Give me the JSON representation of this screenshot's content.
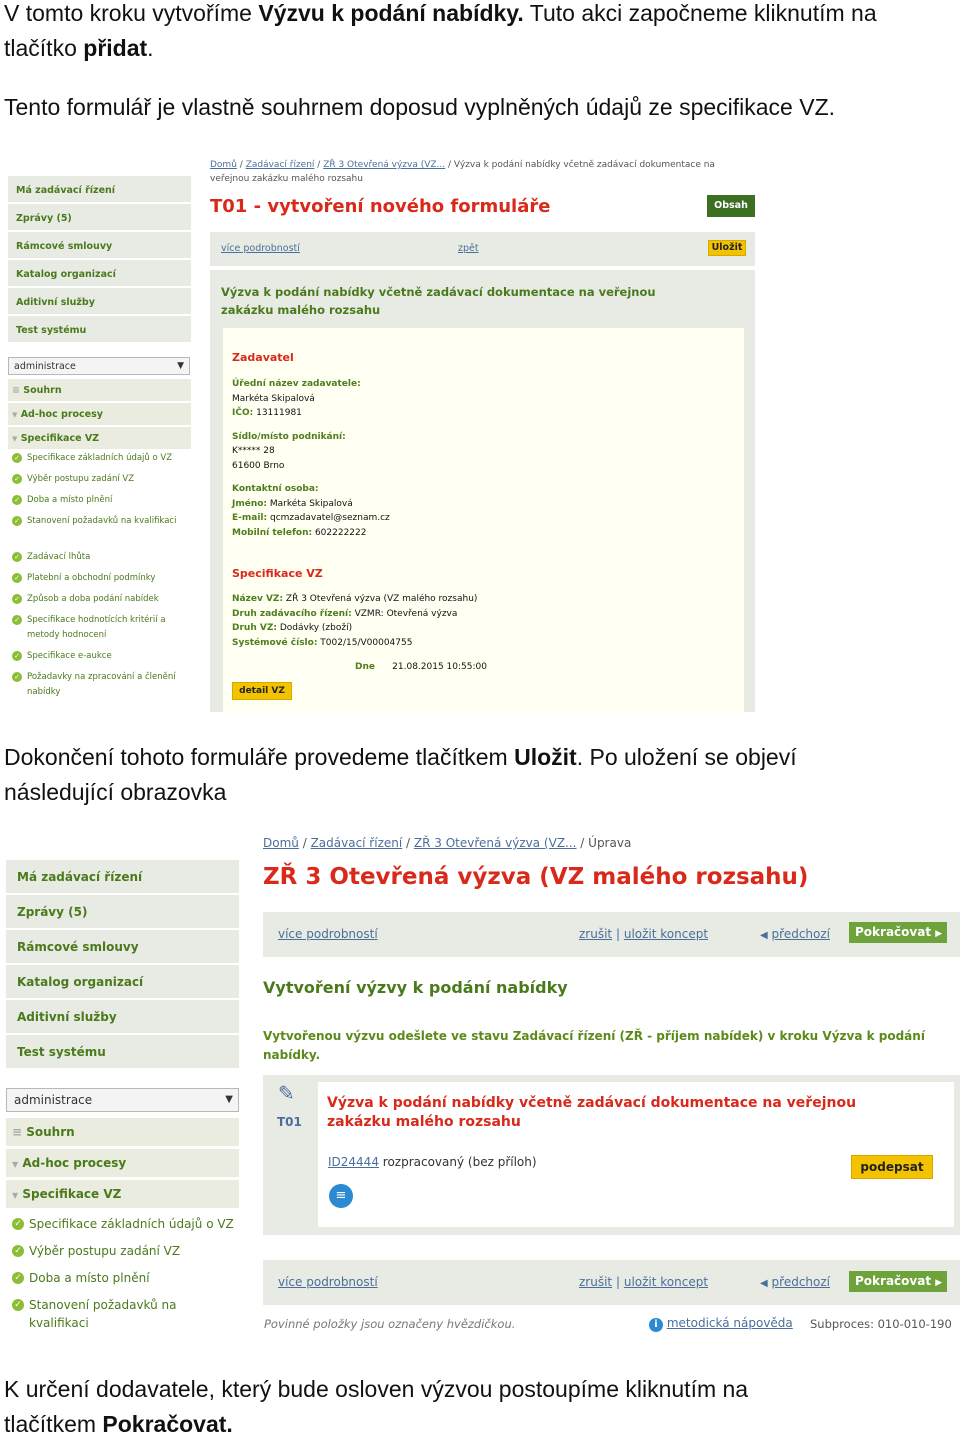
{
  "p1": {
    "a": "V tomto kroku vytvoříme ",
    "b": "Výzvu k podání nabídky.",
    "c": " Tuto akci započneme kliknutím na",
    "d": "tlačítko ",
    "e": "přidat",
    "f": "."
  },
  "p2": "Tento formulář je vlastně souhrnem doposud vyplněných údajů ze specifikace VZ.",
  "p3": {
    "a": "Dokončení tohoto formuláře provedeme tlačítkem ",
    "b": "Uložit",
    "c": ". Po uložení se objeví",
    "d": "následující obrazovka"
  },
  "p4": {
    "a": "K určení dodavatele, který bude osloven výzvou postoupíme kliknutím na",
    "b": "tlačítkem ",
    "c": "Pokračovat."
  },
  "sidebar": {
    "items": [
      "Má zadávací řízení",
      "Zprávy (5)",
      "Rámcové smlouvy",
      "Katalog organizací",
      "Aditivní služby",
      "Test systému"
    ],
    "dropdown": "administrace",
    "summary": "Souhrn",
    "adhoc": "Ad-hoc procesy",
    "spec": "Specifikace VZ",
    "tasks1": [
      "Specifikace základních údajů o VZ",
      "Výběr postupu zadání VZ",
      "Doba a místo plnění",
      "Stanovení požadavků na kvalifikaci",
      "Zadávací lhůta",
      "Platební a obchodní podmínky",
      "Způsob a doba podání nabídek",
      "Specifikace hodnotících kritérií a metody hodnocení",
      "Specifikace e-aukce",
      "Požadavky na zpracování a členění nabídky"
    ],
    "tasks2": [
      "Specifikace základních údajů o VZ",
      "Výběr postupu zadání VZ",
      "Doba a místo plnění",
      "Stanovení požadavků na kvalifikaci"
    ]
  },
  "s1": {
    "bc_home": "Domů",
    "bc_zr": "Zadávací řízení",
    "bc_vz": "ZŘ 3 Otevřená výzva (VZ...",
    "bc_cur1": "Výzva k podání nabídky včetně zadávací dokumentace na",
    "bc_cur2": "veřejnou zakázku malého rozsahu",
    "title": "T01 - vytvoření nového formuláře",
    "obsah": "Obsah",
    "more": "více podrobností",
    "back": "zpět",
    "save": "Uložit",
    "form_title1": "Výzva k podání nabídky včetně zadávací dokumentace na veřejnou",
    "form_title2": "zakázku malého rozsahu",
    "zad_head": "Zadavatel",
    "name_lbl": "Úřední název zadavatele:",
    "name_val": "Markéta Skipalová",
    "ico_lbl": "IČO:",
    "ico_val": "13111981",
    "addr_lbl": "Sídlo/místo podnikání:",
    "addr1": "K***** 28",
    "addr2": "61600  Brno",
    "contact_lbl": "Kontaktní osoba:",
    "jm_lbl": "Jméno:",
    "jm_val": "Markéta Skipalová",
    "em_lbl": "E-mail:",
    "em_val": "qcmzadavatel@seznam.cz",
    "tel_lbl": "Mobilní telefon:",
    "tel_val": "602222222",
    "spec_head": "Specifikace VZ",
    "nazev_lbl": "Název VZ:",
    "nazev_val": "ZŘ 3 Otevřená výzva (VZ malého rozsahu)",
    "druh_zr_lbl": "Druh zadávacího řízení:",
    "druh_zr_val": "VZMR: Otevřená výzva",
    "druh_vz_lbl": "Druh VZ:",
    "druh_vz_val": "Dodávky (zboží)",
    "sys_lbl": "Systémové číslo:",
    "sys_val": "T002/15/V00004755",
    "dne_lbl": "Dne",
    "dne_val": "21.08.2015 10:55:00",
    "detail": "detail VZ"
  },
  "s2": {
    "bc_home": "Domů",
    "bc_zr": "Zadávací řízení",
    "bc_vz": "ZŘ 3 Otevřená výzva (VZ...",
    "bc_cur": "Úprava",
    "title": "ZŘ 3 Otevřená výzva (VZ malého rozsahu)",
    "more": "více podrobností",
    "cancel": "zrušit",
    "sep": "|",
    "draft": "uložit koncept",
    "prev": "předchozí",
    "next": "Pokračovat",
    "sub_title": "Vytvoření výzvy k podání nabídky",
    "info1": "Vytvořenou výzvu odešlete ve stavu Zadávací řízení (ZŘ - příjem nabídek) v kroku Výzva k podání",
    "info2": "nabídky.",
    "doc_code": "T01",
    "doc_title1": "Výzva k podání nabídky včetně zadávací dokumentace na veřejnou",
    "doc_title2": "zakázku malého rozsahu",
    "doc_id": "ID24444",
    "doc_state": "rozpracovaný (bez příloh)",
    "sign": "podepsat",
    "footer_note": "Povinné položky jsou označeny hvězdičkou.",
    "help": "metodická nápověda",
    "subproc": "Subproces: 010-010-190"
  }
}
